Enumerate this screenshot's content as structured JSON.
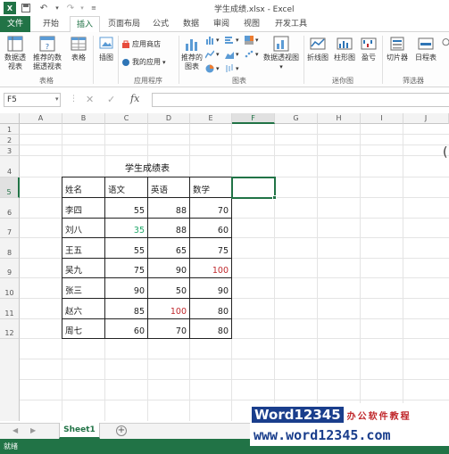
{
  "window": {
    "title": "学生成绩.xlsx - Excel"
  },
  "tabs": [
    "文件",
    "开始",
    "插入",
    "页面布局",
    "公式",
    "数据",
    "审阅",
    "视图",
    "开发工具"
  ],
  "ribbon": {
    "pivot_table": "数据透视表",
    "recommended_pivot": "推荐的数据透视表",
    "table": "表格",
    "illustrations": "插图",
    "app_store": "应用商店",
    "my_apps": "我的应用",
    "recommended_charts": "推荐的图表",
    "pivot_chart": "数据透视图",
    "line": "折线图",
    "column": "柱形图",
    "win_loss": "盈亏",
    "slicer": "切片器",
    "timeline": "日程表",
    "groups": {
      "tables": "表格",
      "apps": "应用程序",
      "charts": "图表",
      "sparklines": "迷你图",
      "filters": "筛选器"
    }
  },
  "formula_bar": {
    "name_box": "F5",
    "fx": "fx",
    "formula": ""
  },
  "columns": [
    "A",
    "B",
    "C",
    "D",
    "E",
    "F",
    "G",
    "H",
    "I",
    "J"
  ],
  "rows": [
    "1",
    "2",
    "3",
    "4",
    "5",
    "6",
    "7",
    "8",
    "9",
    "10",
    "11",
    "12"
  ],
  "sheet": {
    "title": "学生成绩表",
    "headers": [
      "姓名",
      "语文",
      "英语",
      "数学"
    ],
    "records": [
      {
        "name": "李四",
        "chinese": "55",
        "english": "88",
        "math": "70"
      },
      {
        "name": "刘八",
        "chinese": "35",
        "english": "88",
        "math": "60"
      },
      {
        "name": "王五",
        "chinese": "55",
        "english": "65",
        "math": "75"
      },
      {
        "name": "吴九",
        "chinese": "75",
        "english": "90",
        "math": "100"
      },
      {
        "name": "张三",
        "chinese": "90",
        "english": "50",
        "math": "90"
      },
      {
        "name": "赵六",
        "chinese": "85",
        "english": "100",
        "math": "80"
      },
      {
        "name": "周七",
        "chinese": "60",
        "english": "70",
        "math": "80"
      }
    ]
  },
  "sheet_tabs": {
    "active": "Sheet1"
  },
  "status": {
    "text": "就绪"
  },
  "watermark": {
    "brand": "Word12345",
    "slogan": "办公软件教程",
    "url": "www.word12345.com"
  },
  "colors": {
    "accent": "#217346",
    "green_value": "#22a86a",
    "red_value": "#c0282c"
  }
}
